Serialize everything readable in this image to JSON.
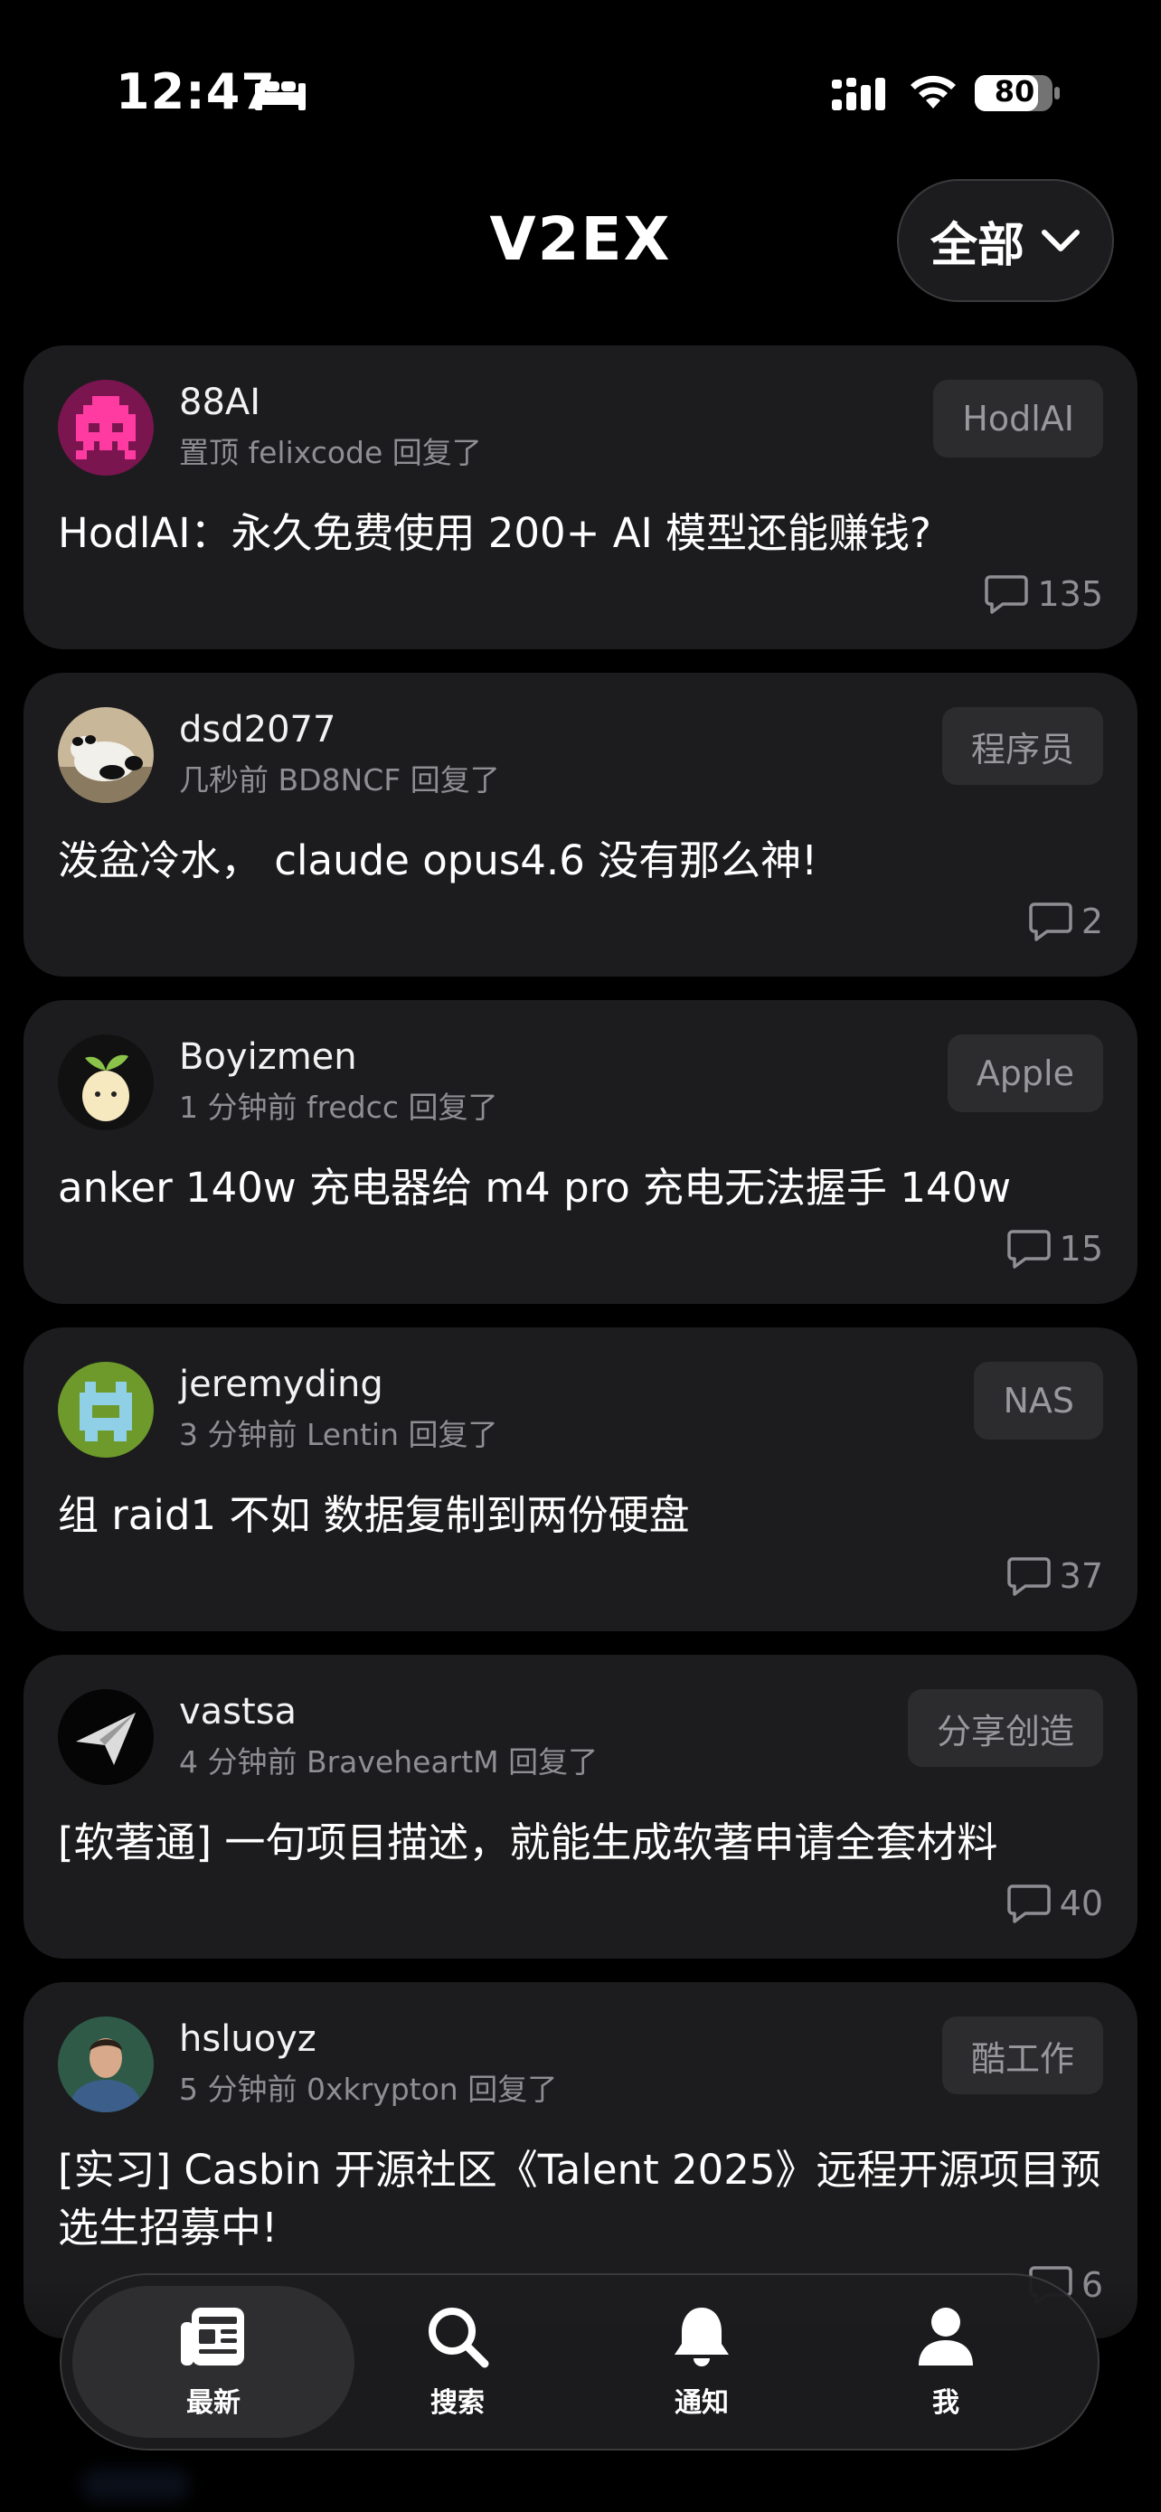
{
  "status_bar": {
    "time": "12:47",
    "battery": "80"
  },
  "nav": {
    "brand": "V2EX",
    "filter_label": "全部"
  },
  "topics": [
    {
      "username": "88AI",
      "meta": "置顶 felixcode 回复了",
      "node": "HodlAI",
      "title": "HodlAI：永久免费使用 200+ AI 模型还能赚钱?",
      "replies": "135",
      "avatar": "pixel-invader-avatar"
    },
    {
      "username": "dsd2077",
      "meta": "几秒前 BD8NCF 回复了",
      "node": "程序员",
      "title": "泼盆冷水， claude opus4.6 没有那么神!",
      "replies": "2",
      "avatar": "panda-avatar"
    },
    {
      "username": "Boyizmen",
      "meta": "1 分钟前 fredcc 回复了",
      "node": "Apple",
      "title": "anker 140w 充电器给 m4 pro 充电无法握手 140w",
      "replies": "15",
      "avatar": "sprout-avatar"
    },
    {
      "username": "jeremyding",
      "meta": "3 分钟前 Lentin 回复了",
      "node": "NAS",
      "title": "组 raid1 不如 数据复制到两份硬盘",
      "replies": "37",
      "avatar": "pixel-robot-avatar"
    },
    {
      "username": "vastsa",
      "meta": "4 分钟前 BraveheartM 回复了",
      "node": "分享创造",
      "title": "[软著通] 一句项目描述，就能生成软著申请全套材料",
      "replies": "40",
      "avatar": "paper-plane-avatar"
    },
    {
      "username": "hsluoyz",
      "meta": "5 分钟前 0xkrypton 回复了",
      "node": "酷工作",
      "title": "[实习] Casbin 开源社区《Talent 2025》远程开源项目预选生招募中!",
      "replies": "6",
      "avatar": "photo-avatar"
    }
  ],
  "tabs": [
    {
      "label": "最新",
      "icon": "newspaper-icon",
      "active": true
    },
    {
      "label": "搜索",
      "icon": "search-icon",
      "active": false
    },
    {
      "label": "通知",
      "icon": "bell-icon",
      "active": false
    },
    {
      "label": "我",
      "icon": "person-icon",
      "active": false
    }
  ],
  "colors": {
    "background": "#000000",
    "card": "#1c1c1e",
    "tag_bg": "#2c2c2e",
    "secondary_text": "#8e8e93"
  }
}
